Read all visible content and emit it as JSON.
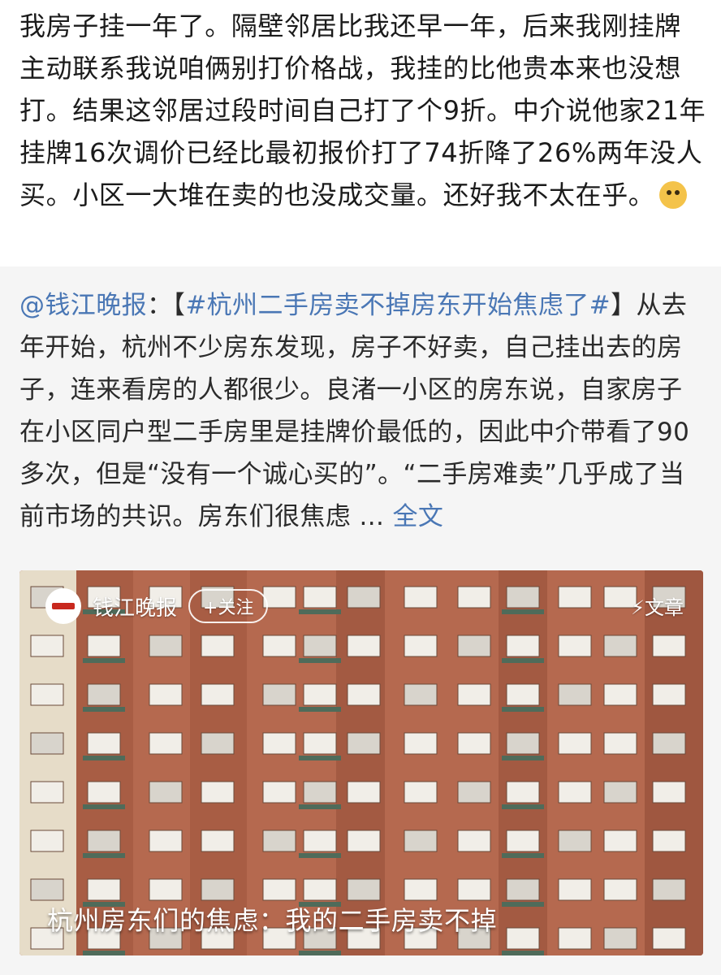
{
  "post": {
    "text": "我房子挂一年了。隔壁邻居比我还早一年，后来我刚挂牌主动联系我说咱俩别打价格战，我挂的比他贵本来也没想打。结果这邻居过段时间自己打了个9折。中介说他家21年挂牌16次调价已经比最初报价打了74折降了26%两年没人买。小区一大堆在卖的也没成交量。还好我不太在乎。"
  },
  "emoji": "doge",
  "repost": {
    "author": "@钱江晚报",
    "separator": "：【",
    "hashtag": "#杭州二手房卖不掉房东开始焦虑了#",
    "body": "】从去年开始，杭州不少房东发现，房子不好卖，自己挂出去的房子，连来看房的人都很少。良渚一小区的房东说，自家房子在小区同户型二手房里是挂牌价最低的，因此中介带看了90多次，但是“没有一个诚心买的”。“二手房难卖”几乎成了当前市场的共识。房东们很焦虑",
    "ellipsis": " ... ",
    "full_text_link": "全文"
  },
  "article_card": {
    "source_name": "钱江晚报",
    "follow_label": "+关注",
    "type_tag": "⚡文章",
    "caption": "杭州房东们的焦虑：我的二手房卖不掉"
  },
  "icons": [
    "doge-emoji-icon",
    "source-logo-icon",
    "lightning-icon"
  ],
  "colors": {
    "link": "#4a77b5",
    "repost_bg": "#f5f5f5",
    "brick": "#b5694f"
  }
}
